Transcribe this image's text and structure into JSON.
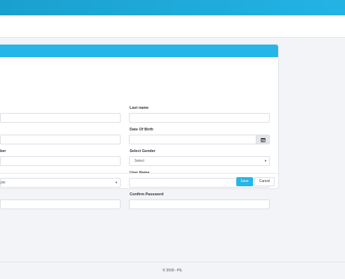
{
  "form": {
    "fields": {
      "first_name": {
        "value": ""
      },
      "last_name": {
        "label": "Last name",
        "value": ""
      },
      "field_row2_left": {
        "value": ""
      },
      "date_of_birth": {
        "label": "Date Of Birth",
        "value": ""
      },
      "number_field": {
        "label_partial": "ber",
        "value": ""
      },
      "select_gender": {
        "label": "Select Gender",
        "selected": "Select"
      },
      "select_row4_left": {
        "selected_partial": "ple"
      },
      "user_name": {
        "label": "User Name",
        "value": ""
      },
      "password": {
        "value": ""
      },
      "confirm_password": {
        "label": "Confirm Password",
        "value": ""
      }
    },
    "buttons": {
      "save_label": "Save",
      "cancel_label": "Cancel"
    }
  },
  "footer": {
    "text": "© 2018 - PIL"
  },
  "icons": {
    "calendar": "calendar-icon",
    "caret": "chevron-down-icon"
  },
  "colors": {
    "topbar": "#22b3e4",
    "card_header": "#24b6e8",
    "save_button": "#24b6e8",
    "page_background": "#f3f4f8"
  }
}
